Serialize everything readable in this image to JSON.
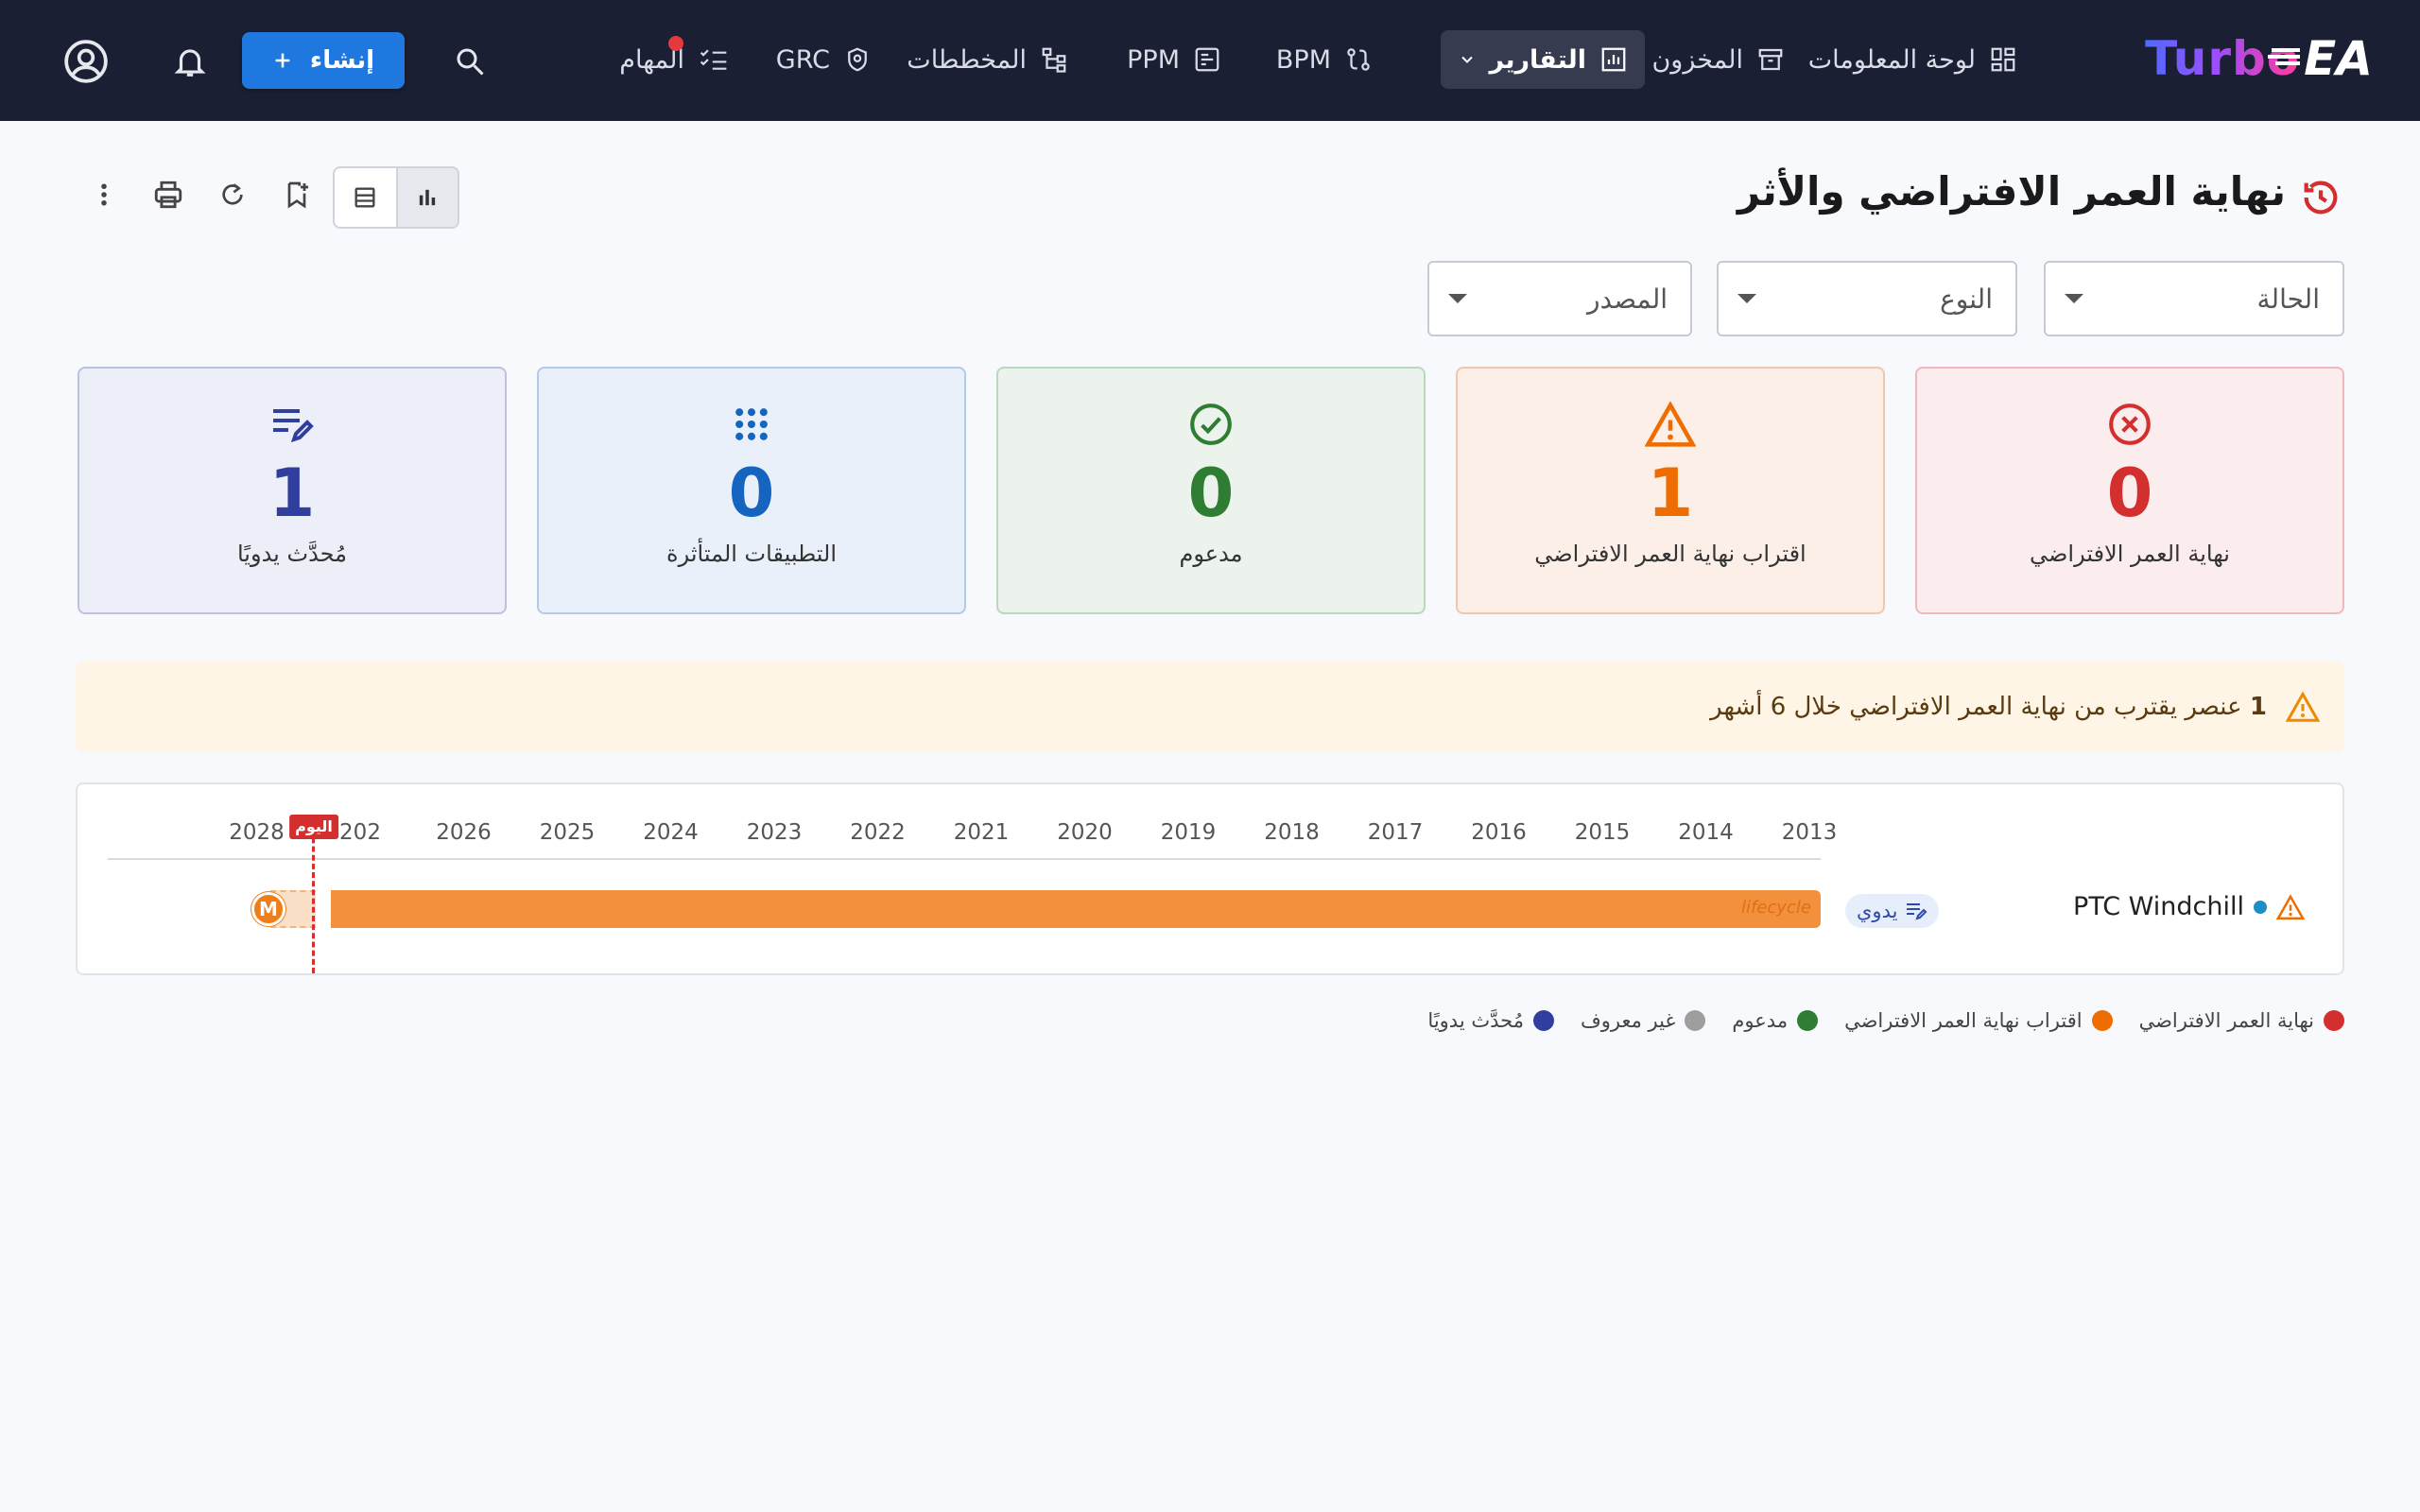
{
  "app": {
    "logo_text": "Turbo",
    "logo_suffix": "EA"
  },
  "nav": {
    "dashboard": "لوحة المعلومات",
    "inventory": "المخزون",
    "reports": "التقارير",
    "bpm": "BPM",
    "ppm": "PPM",
    "diagrams": "المخططات",
    "grc": "GRC",
    "tasks": "المهام",
    "create": "إنشاء"
  },
  "page": {
    "title": "نهاية العمر الافتراضي والأثر"
  },
  "filters": {
    "status": "الحالة",
    "type": "النوع",
    "source": "المصدر"
  },
  "stats": [
    {
      "label": "نهاية العمر الافتراضي",
      "value": "0",
      "color": "#d32f2f"
    },
    {
      "label": "اقتراب نهاية العمر الافتراضي",
      "value": "1",
      "color": "#ef6c00"
    },
    {
      "label": "مدعوم",
      "value": "0",
      "color": "#2e7d32"
    },
    {
      "label": "التطبيقات المتأثرة",
      "value": "0",
      "color": "#1565c0"
    },
    {
      "label": "مُحدَّث يدويًا",
      "value": "1",
      "color": "#303f9f"
    }
  ],
  "alert": {
    "count": "1",
    "text": "عنصر يقترب من نهاية العمر الافتراضي خلال 6 أشهر"
  },
  "timeline": {
    "years": [
      "2013",
      "2014",
      "2015",
      "2016",
      "2017",
      "2018",
      "2019",
      "2020",
      "2021",
      "2022",
      "2023",
      "2024",
      "2025",
      "2026",
      "202",
      "2028"
    ],
    "today_label": "اليوم",
    "rows": [
      {
        "name": "PTC Windchill",
        "source_chip": "يدوي",
        "bar_label": "lifecycle",
        "marker": "M"
      }
    ]
  },
  "legend": [
    {
      "label": "نهاية العمر الافتراضي",
      "color": "#d32f2f"
    },
    {
      "label": "اقتراب نهاية العمر الافتراضي",
      "color": "#ef6c00"
    },
    {
      "label": "مدعوم",
      "color": "#2e7d32"
    },
    {
      "label": "غير معروف",
      "color": "#9e9e9e"
    },
    {
      "label": "مُحدَّث يدويًا",
      "color": "#303f9f"
    }
  ]
}
